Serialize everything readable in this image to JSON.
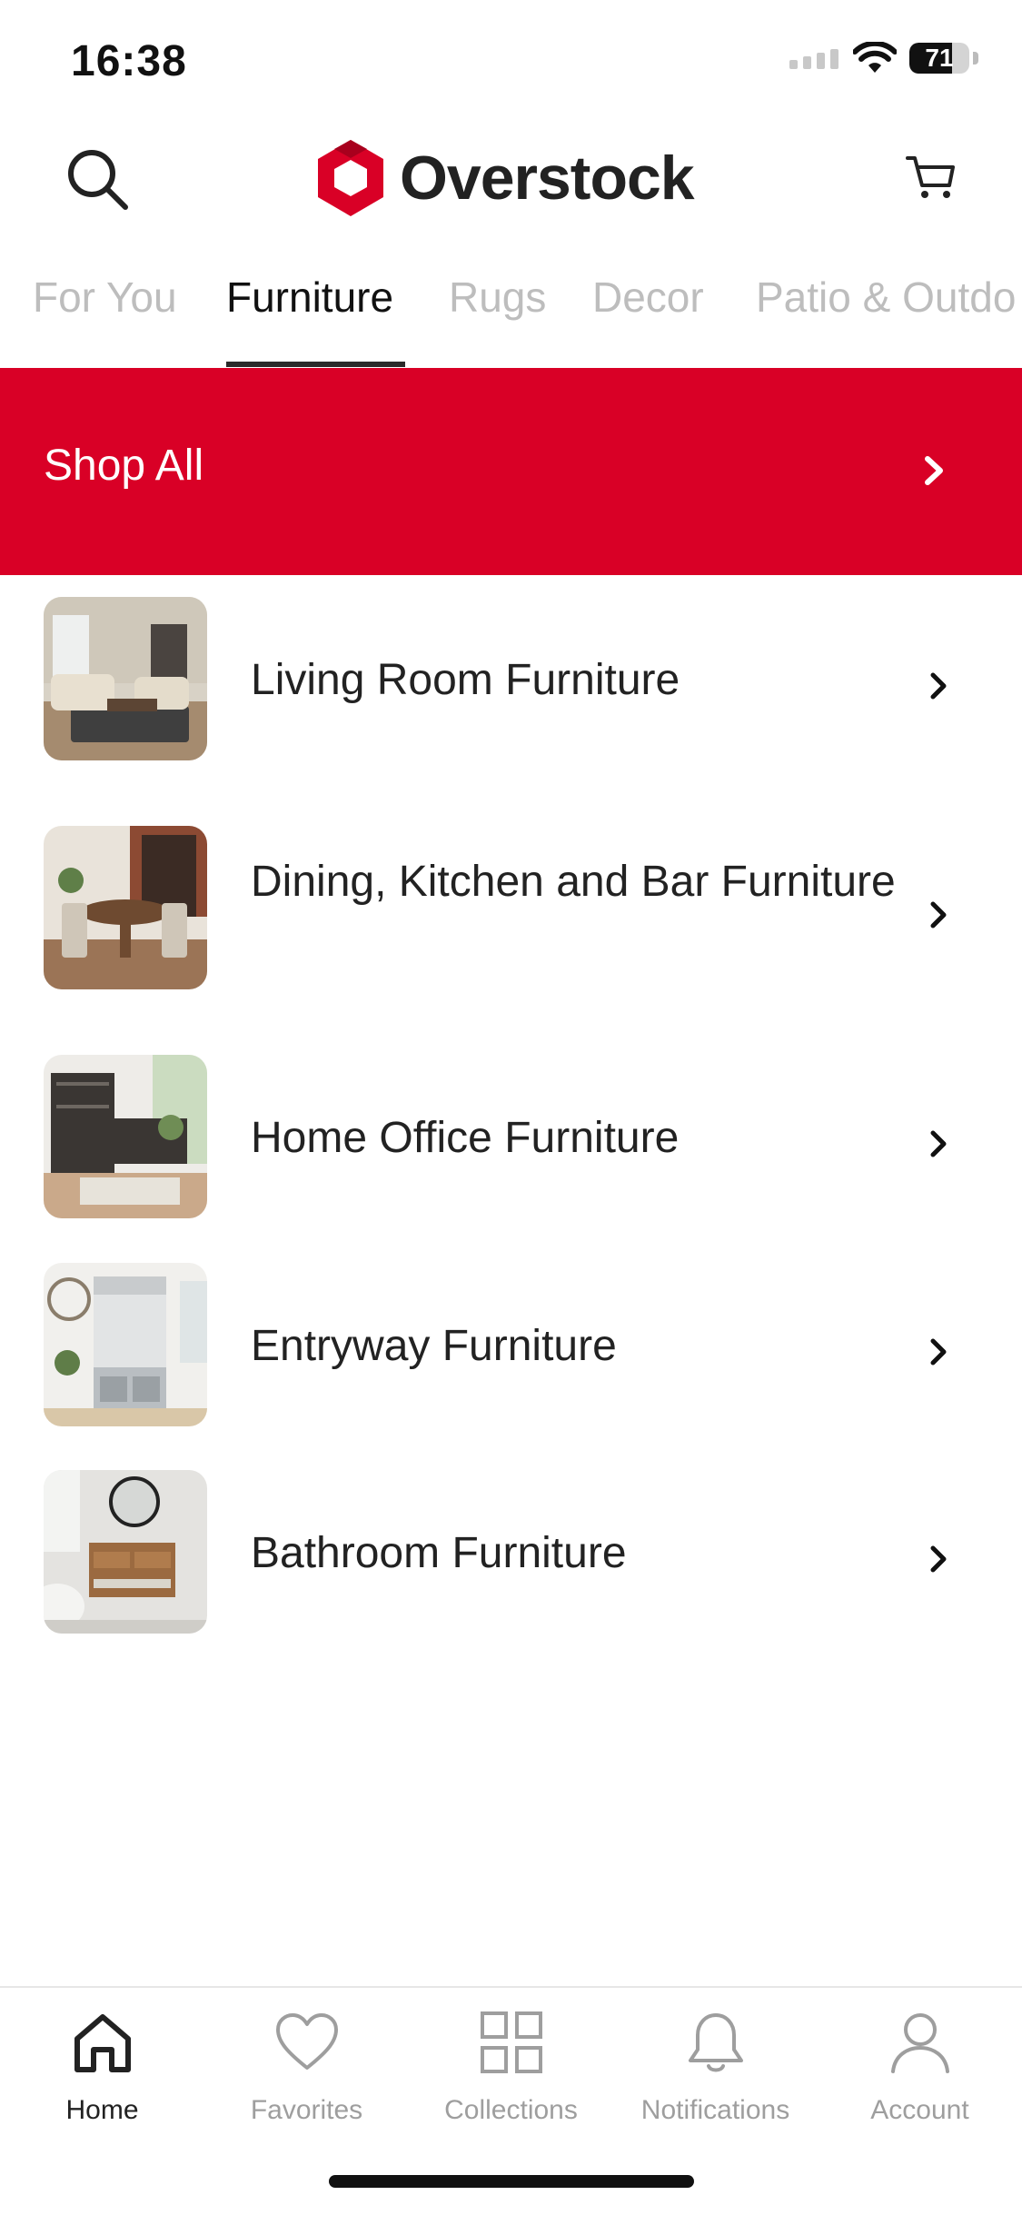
{
  "status_bar": {
    "time": "16:38",
    "battery_level": "71",
    "battery_fraction": 0.71
  },
  "header": {
    "logo_text": "Overstock",
    "brand_color": "#d90026",
    "icons": [
      "search-icon",
      "cart-icon"
    ]
  },
  "tabs": [
    {
      "label": "For You",
      "active": false
    },
    {
      "label": "Furniture",
      "active": true
    },
    {
      "label": "Rugs",
      "active": false
    },
    {
      "label": "Decor",
      "active": false
    },
    {
      "label": "Patio & Outdo",
      "active": false
    }
  ],
  "shop_all": {
    "label": "Shop All",
    "color": "#d90026"
  },
  "categories": [
    {
      "label": "Living Room Furniture",
      "icon": "living-room-image"
    },
    {
      "label": "Dining, Kitchen and Bar Furniture",
      "icon": "dining-room-image"
    },
    {
      "label": "Home Office Furniture",
      "icon": "home-office-image"
    },
    {
      "label": "Entryway Furniture",
      "icon": "entryway-image"
    },
    {
      "label": "Bathroom Furniture",
      "icon": "bathroom-image"
    }
  ],
  "bottom_nav": [
    {
      "label": "Home",
      "icon": "home-icon",
      "active": true
    },
    {
      "label": "Favorites",
      "icon": "heart-icon",
      "active": false
    },
    {
      "label": "Collections",
      "icon": "grid-icon",
      "active": false
    },
    {
      "label": "Notifications",
      "icon": "bell-icon",
      "active": false
    },
    {
      "label": "Account",
      "icon": "person-icon",
      "active": false
    }
  ]
}
